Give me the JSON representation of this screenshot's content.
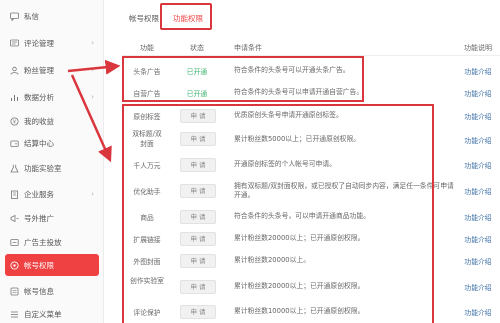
{
  "sidebar": {
    "items": [
      {
        "label": "私信",
        "icon": "chat-icon",
        "chevron": false
      },
      {
        "label": "评论管理",
        "icon": "comment-icon",
        "chevron": true
      },
      {
        "label": "粉丝管理",
        "icon": "fans-icon",
        "chevron": true
      },
      {
        "label": "数据分析",
        "icon": "chart-icon",
        "chevron": true
      },
      {
        "label": "我的收益",
        "icon": "coin-icon",
        "chevron": false
      },
      {
        "label": "结算中心",
        "icon": "wallet-icon",
        "chevron": false
      },
      {
        "label": "功能实验室",
        "icon": "lab-icon",
        "chevron": false
      },
      {
        "label": "企业服务",
        "icon": "building-icon",
        "chevron": true
      },
      {
        "label": "号外推广",
        "icon": "promote-icon",
        "chevron": false
      },
      {
        "label": "广告主投放",
        "icon": "ad-icon",
        "chevron": false
      },
      {
        "label": "帐号权限",
        "icon": "account-icon",
        "chevron": false,
        "active": true
      },
      {
        "label": "帐号信息",
        "icon": "info-icon",
        "chevron": false
      },
      {
        "label": "自定义菜单",
        "icon": "menu-icon",
        "chevron": false
      }
    ]
  },
  "tabs": [
    {
      "label": "帐号权限"
    },
    {
      "label": "功能权限",
      "active": true
    }
  ],
  "table": {
    "headers": {
      "name": "功能",
      "status": "状态",
      "condition": "申请条件",
      "intro": "功能说明"
    },
    "rows": [
      {
        "name": "头条广告",
        "status": "已开通",
        "condition": "符合条件的头条号可以开通头条广告。",
        "intro": "功能介绍"
      },
      {
        "name": "自营广告",
        "status": "已开通",
        "condition": "符合条件的头条号可以申请开通自营广告。",
        "intro": "功能介绍"
      },
      {
        "name": "原创标签",
        "status": "申 请",
        "condition": "优质原创头条号申请开通原创标签。",
        "intro": "功能介绍"
      },
      {
        "name": "双标题/双封面",
        "status": "申 请",
        "condition": "累计粉丝数5000以上；已开通原创权限。",
        "intro": "功能介绍"
      },
      {
        "name": "千人万元",
        "status": "申 请",
        "condition": "开通原创标签的个人帐号可申请。",
        "intro": "功能介绍"
      },
      {
        "name": "优化助手",
        "status": "申 请",
        "condition": "拥有双标题/双封面权限，或已授权了自动同步内容，满足任一条件可申请开通。",
        "intro": "功能介绍"
      },
      {
        "name": "商品",
        "status": "申 请",
        "condition": "符合条件的头条号，可以申请开通商品功能。",
        "intro": "功能介绍"
      },
      {
        "name": "扩展链接",
        "status": "申 请",
        "condition": "累计粉丝数20000以上；已开通原创权限。",
        "intro": "功能介绍"
      },
      {
        "name": "外图封面",
        "status": "申 请",
        "condition": "累计粉丝数20000以上。",
        "intro": "功能介绍"
      },
      {
        "name": "创作实验室",
        "status": "申 请",
        "condition": "累计粉丝数20000以上；已开通原创权限。",
        "intro": "功能介绍"
      },
      {
        "name": "评论保护",
        "status": "申 请",
        "condition": "累计粉丝数10000以上；已开通原创权限。",
        "intro": "功能介绍"
      }
    ]
  },
  "colors": {
    "accent": "#f04142",
    "open": "#3cb371",
    "link": "#3a6ea5",
    "annotation": "#d9363e"
  }
}
